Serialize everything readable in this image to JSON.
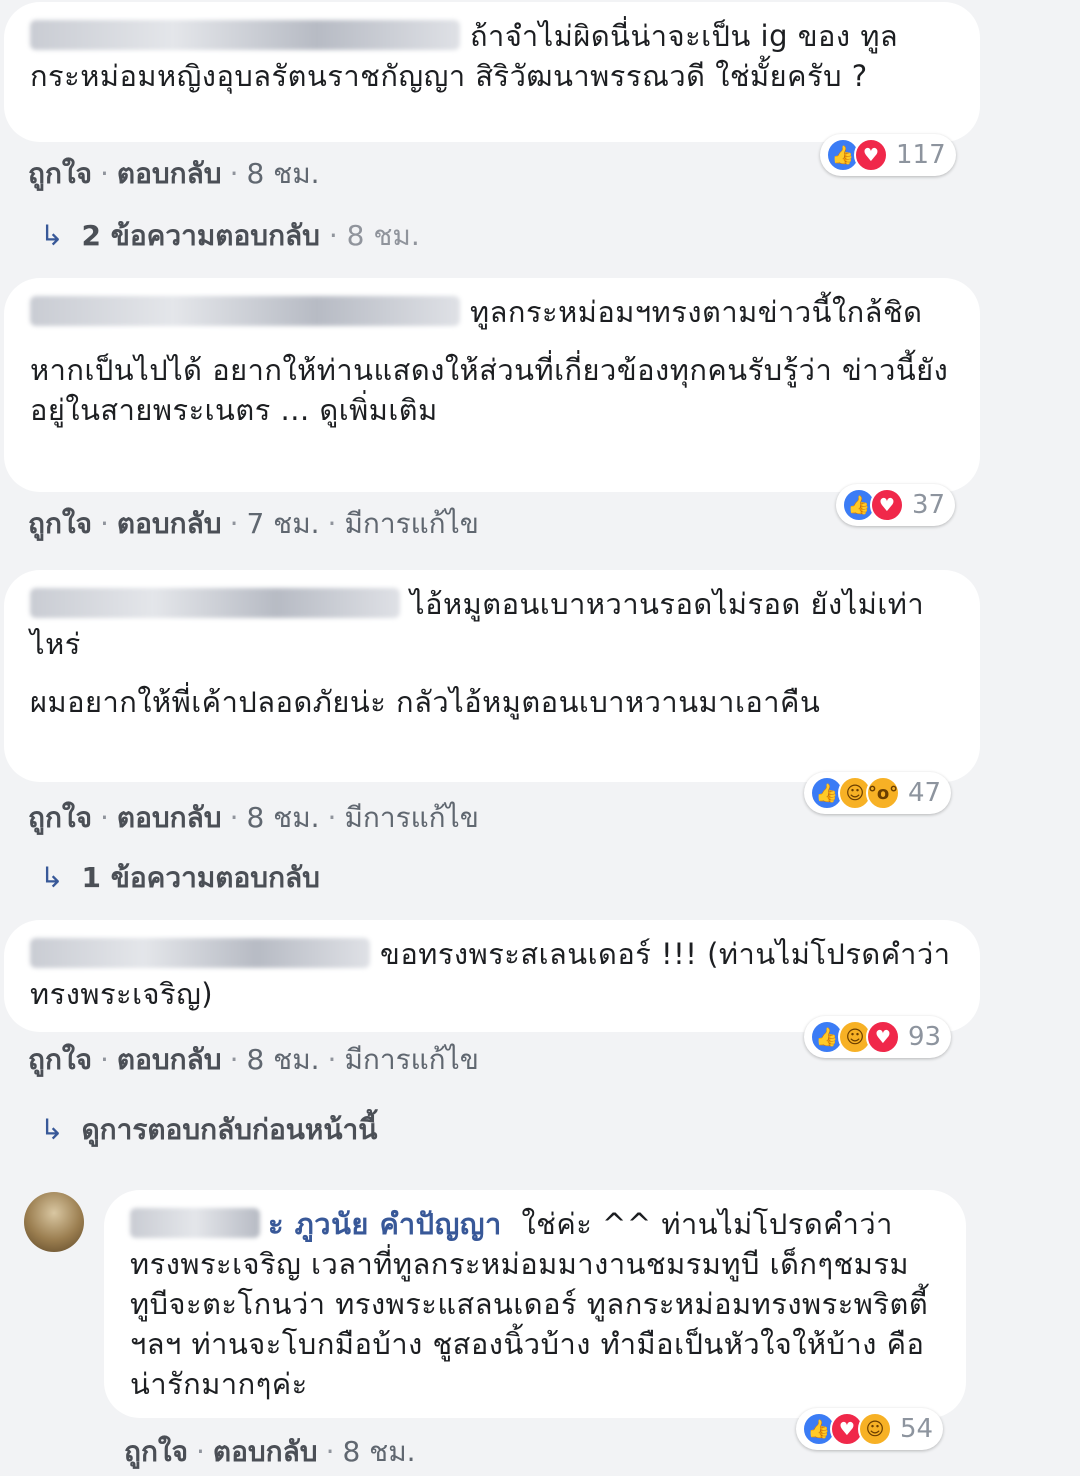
{
  "comments": [
    {
      "lines": [
        "ถ้าจำไม่ผิดนี่น่าจะเป็น ig ของ ทูลกระหม่อมหญิงอุบลรัตนราชกัญญา สิริวัฒนาพรรณวดี ใช่มั้ยครับ ?"
      ],
      "meta": {
        "like": "ถูกใจ",
        "reply": "ตอบกลับ",
        "time": "8 ชม."
      },
      "reactions": {
        "icons": [
          "like-icon",
          "love-icon"
        ],
        "count": "117"
      },
      "replies": {
        "label": "2 ข้อความตอบกลับ",
        "time": "8 ชม."
      }
    },
    {
      "lines": [
        "ทูลกระหม่อมฯทรงตามข่าวนี้ใกล้ชิด",
        "หากเป็นไปได้ อยากให้ท่านแสดงให้ส่วนที่เกี่ยวข้องทุกคนรับรู้ว่า ข่าวนี้ยังอยู่ในสายพระเนตร ... ดูเพิ่มเติม"
      ],
      "meta": {
        "like": "ถูกใจ",
        "reply": "ตอบกลับ",
        "time": "7 ชม.",
        "edited": "มีการแก้ไข"
      },
      "reactions": {
        "icons": [
          "like-icon",
          "love-icon"
        ],
        "count": "37"
      }
    },
    {
      "lines": [
        "ไอ้หมูตอนเบาหวานรอดไม่รอด ยังไม่เท่าไหร่",
        "ผมอยากให้พี่เค้าปลอดภัยน่ะ กลัวไอ้หมูตอนเบาหวานมาเอาคืน"
      ],
      "meta": {
        "like": "ถูกใจ",
        "reply": "ตอบกลับ",
        "time": "8 ชม.",
        "edited": "มีการแก้ไข"
      },
      "reactions": {
        "icons": [
          "like-icon",
          "haha-icon",
          "wow-icon"
        ],
        "count": "47"
      },
      "replies": {
        "label": "1 ข้อความตอบกลับ",
        "time": ""
      }
    },
    {
      "lines": [
        "ขอทรงพระสเลนเดอร์ !!! (ท่านไม่โปรดคำว่า ทรงพระเจริญ)"
      ],
      "meta": {
        "like": "ถูกใจ",
        "reply": "ตอบกลับ",
        "time": "8 ชม.",
        "edited": "มีการแก้ไข"
      },
      "reactions": {
        "icons": [
          "like-icon",
          "haha-icon",
          "love-icon"
        ],
        "count": "93"
      },
      "replies": {
        "label": "ดูการตอบกลับก่อนหน้านี้",
        "time": ""
      }
    },
    {
      "author_suffix": "ะ ภูวนัย คำปัญญา",
      "lines": [
        "ใช่ค่ะ ^^ ท่านไม่โปรดคำว่า ทรงพระเจริญ เวลาที่ทูลกระหม่อมมางานชมรมทูบี เด็กๆชมรมทูบีจะตะโกนว่า ทรงพระแสลนเดอร์ ทูลกระหม่อมทรงพระพริตตี้ ฯลฯ ท่านจะโบกมือบ้าง ชูสองนิ้วบ้าง ทำมือเป็นหัวใจให้บ้าง คือน่ารักมากๆค่ะ"
      ],
      "meta": {
        "like": "ถูกใจ",
        "reply": "ตอบกลับ",
        "time": "8 ชม."
      },
      "reactions": {
        "icons": [
          "like-icon",
          "love-icon",
          "haha-icon"
        ],
        "count": "54"
      }
    }
  ]
}
